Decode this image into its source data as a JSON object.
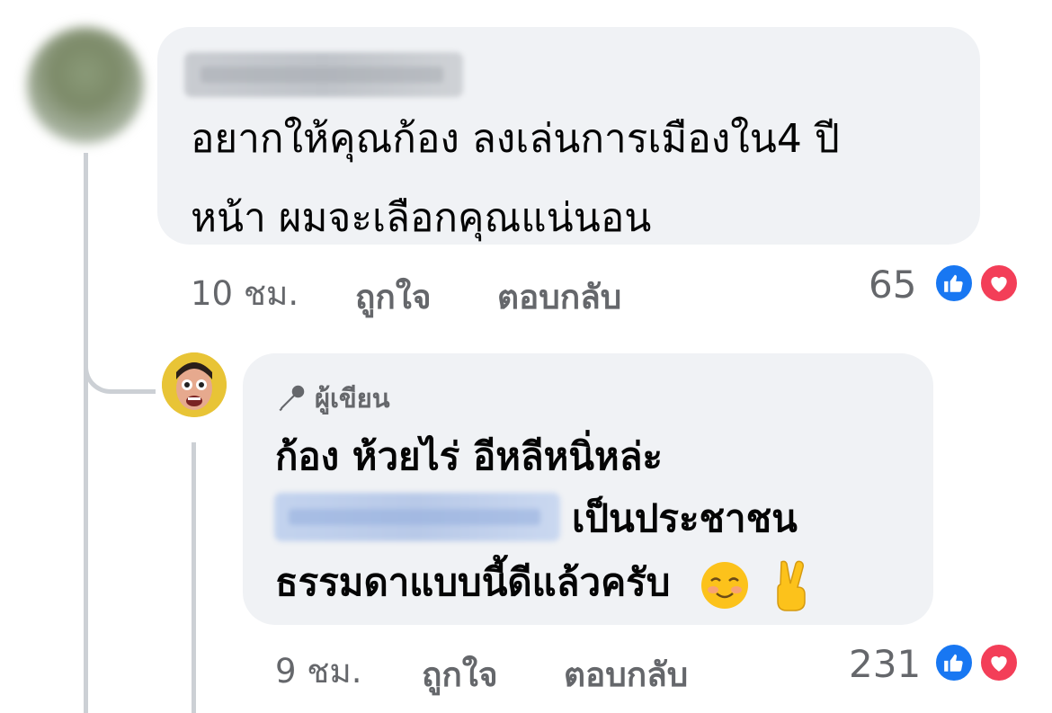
{
  "comment": {
    "text_line1": "อยากให้คุณก้อง ลงเล่นการเมืองใน4 ปี",
    "text_line2": "หน้า ผมจะเลือกคุณแน่นอน",
    "time": "10 ชม.",
    "like_label": "ถูกใจ",
    "reply_label": "ตอบกลับ",
    "reaction_count": "65",
    "reactions": [
      "like-icon",
      "love-icon"
    ]
  },
  "reply": {
    "author_badge": "ผู้เขียน",
    "badge_icon": "microphone-icon",
    "text_line1": "ก้อง ห้วยไร่ อีหลีหนิ่หล่ะ",
    "text_line2": "เป็นประชาชน",
    "text_line3": "ธรรมดาแบบนี้ดีแล้วครับ",
    "emojis": [
      "smiling-face-emoji",
      "victory-hand-emoji"
    ],
    "time": "9 ชม.",
    "like_label": "ถูกใจ",
    "reply_label": "ตอบกลับ",
    "reaction_count": "231",
    "reactions": [
      "like-icon",
      "love-icon"
    ]
  },
  "colors": {
    "bubble_bg": "#f0f2f5",
    "meta_text": "#65676b",
    "like_blue": "#1877f2",
    "love_red": "#f33e58"
  }
}
